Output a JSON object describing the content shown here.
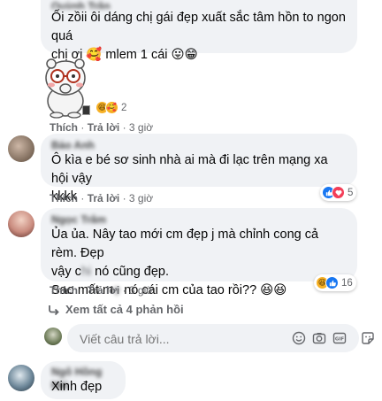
{
  "comments": [
    {
      "author": "Quỳnh Trân",
      "lines": [
        "Ối zồii ôi dáng chị gái đẹp xuất sắc tâm hồn to ngon quá",
        "chị ơi 🥰 mlem 1 cái 😛😁"
      ],
      "reaction_count": "2",
      "action_like": "Thích",
      "action_reply": "Trả lời",
      "time": "3 giờ"
    },
    {
      "author": "Bảo Anh",
      "lines": [
        "Ô kìa e bé sơ sinh nhà ai mà đi lạc trên mạng xa hội vậy",
        "kkkk"
      ],
      "reaction_count": "5",
      "action_like": "Thích",
      "action_reply": "Trả lời",
      "time": "3 giờ"
    },
    {
      "author": "Ngọc Trâm",
      "line1": "Ủa ủa. Nây tao mới cm đẹp j mà chỉnh cong cả rèm. Đẹp",
      "line2_a": "vậy c",
      "line2_b": " nó cũng đẹp.",
      "line3_a": "Sao mất m",
      "line3_b": " nó cái cm của tao rồi?? 😆😆",
      "reaction_count": "16",
      "action_like": "Thích",
      "action_reply": "Trả lời",
      "time": "3 giờ"
    },
    {
      "author": "Ngô Hồng Hải",
      "lines": [
        "Xinh đẹp"
      ]
    }
  ],
  "view_replies": "Xem tất cả 4 phản hồi",
  "reply_input": {
    "placeholder": "Viết câu trả lời..."
  },
  "colors": {
    "bubble": "#f0f2f5",
    "secondary_text": "#65676b",
    "like_blue": "#1877f2",
    "love_red": "#f33e58",
    "haha_yellow": "#f7b125"
  },
  "icons": [
    "sticker-character",
    "emoji-icon",
    "camera-icon",
    "gif-icon",
    "sticker-icon",
    "like-reaction-icon",
    "love-reaction-icon",
    "haha-reaction-icon",
    "reply-arrow-icon"
  ]
}
